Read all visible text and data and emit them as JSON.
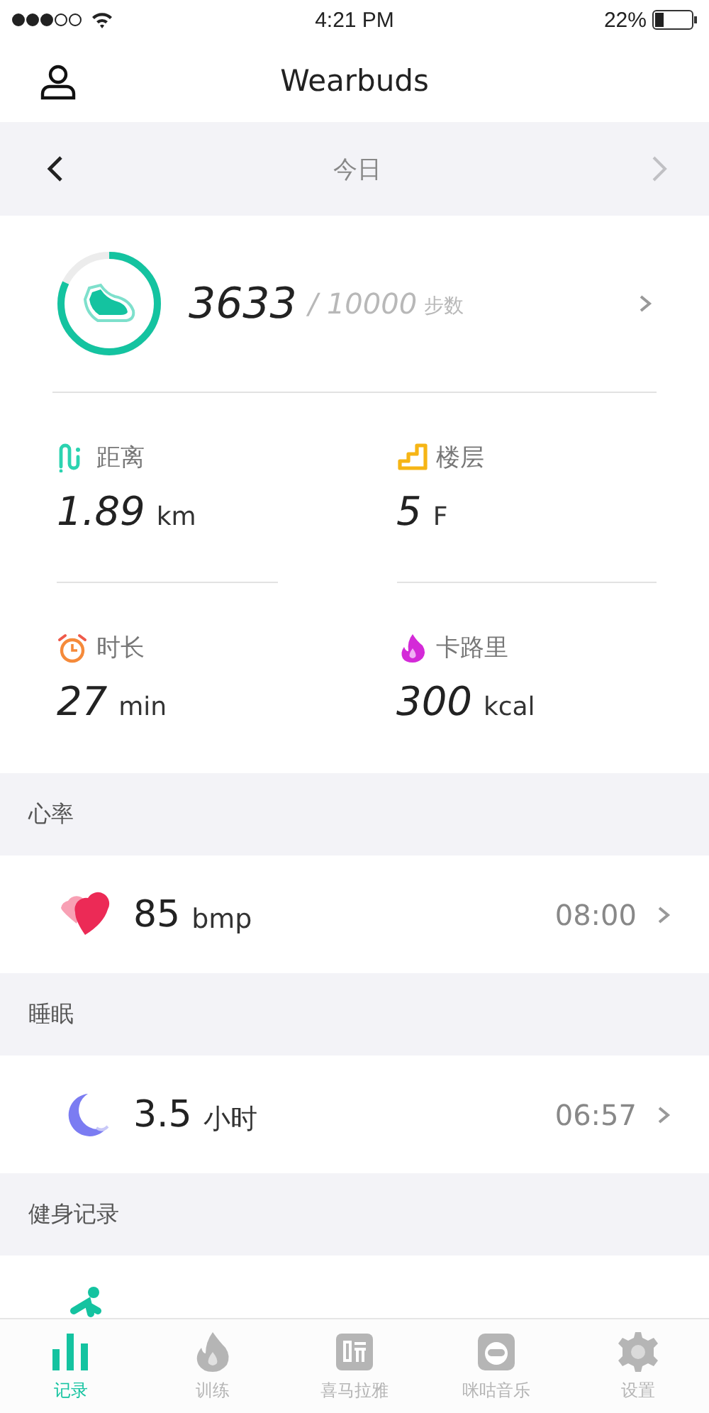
{
  "status_bar": {
    "time": "4:21 PM",
    "battery": "22%"
  },
  "header": {
    "title": "Wearbuds"
  },
  "date_nav": {
    "label": "今日",
    "prev_disabled": false,
    "next_disabled": true
  },
  "steps": {
    "value": "3633",
    "goal": "/ 10000",
    "unit": "步数",
    "level": 0.82
  },
  "stats": [
    {
      "kind": "distance",
      "label": "距离",
      "value": "1.89",
      "unit": "km"
    },
    {
      "kind": "floors",
      "label": "楼层",
      "value": "5",
      "unit": "F"
    },
    {
      "kind": "duration",
      "label": "时长",
      "value": "27",
      "unit": "min"
    },
    {
      "kind": "calories",
      "label": "卡路里",
      "value": "300",
      "unit": "kcal"
    }
  ],
  "sections": [
    {
      "title": "心率",
      "kind": "heart",
      "value": "85",
      "unit": "bmp",
      "time": "08:00"
    },
    {
      "title": "睡眠",
      "kind": "sleep",
      "value": "3.5",
      "unit": "小时",
      "time": "06:57"
    },
    {
      "title": "健身记录",
      "kind": "fitness"
    }
  ],
  "tabs": [
    {
      "kind": "records",
      "label": "记录",
      "selected": true
    },
    {
      "kind": "training",
      "label": "训练",
      "selected": false
    },
    {
      "kind": "ximalaya",
      "label": "喜马拉雅",
      "selected": false
    },
    {
      "kind": "migu",
      "label": "咪咕音乐",
      "selected": false
    },
    {
      "kind": "settings",
      "label": "设置",
      "selected": false
    }
  ]
}
